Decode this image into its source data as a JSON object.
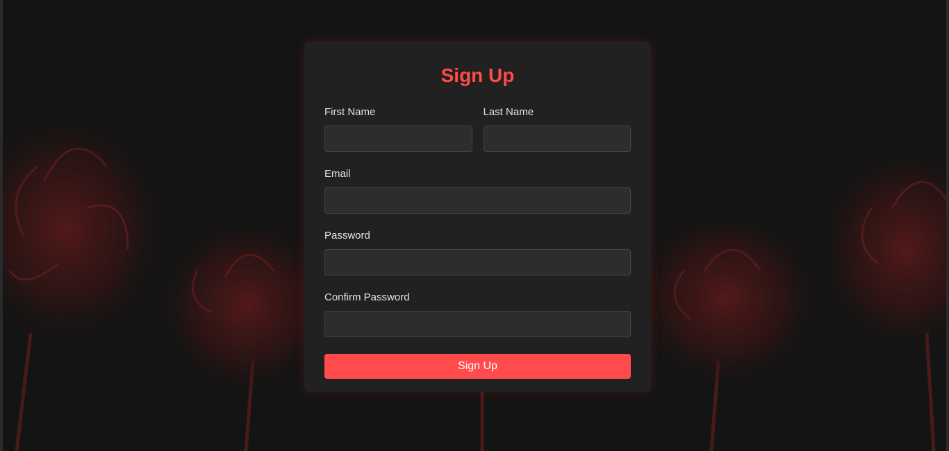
{
  "form": {
    "title": "Sign Up",
    "first_name": {
      "label": "First Name",
      "value": "",
      "placeholder": ""
    },
    "last_name": {
      "label": "Last Name",
      "value": "",
      "placeholder": ""
    },
    "email": {
      "label": "Email",
      "value": "",
      "placeholder": ""
    },
    "password": {
      "label": "Password",
      "value": "",
      "placeholder": ""
    },
    "confirm_password": {
      "label": "Confirm Password",
      "value": "",
      "placeholder": ""
    },
    "submit_label": "Sign Up"
  },
  "colors": {
    "accent": "#ff4b4b",
    "card": "#212121",
    "field": "#2d2d2d",
    "background": "#141414"
  }
}
